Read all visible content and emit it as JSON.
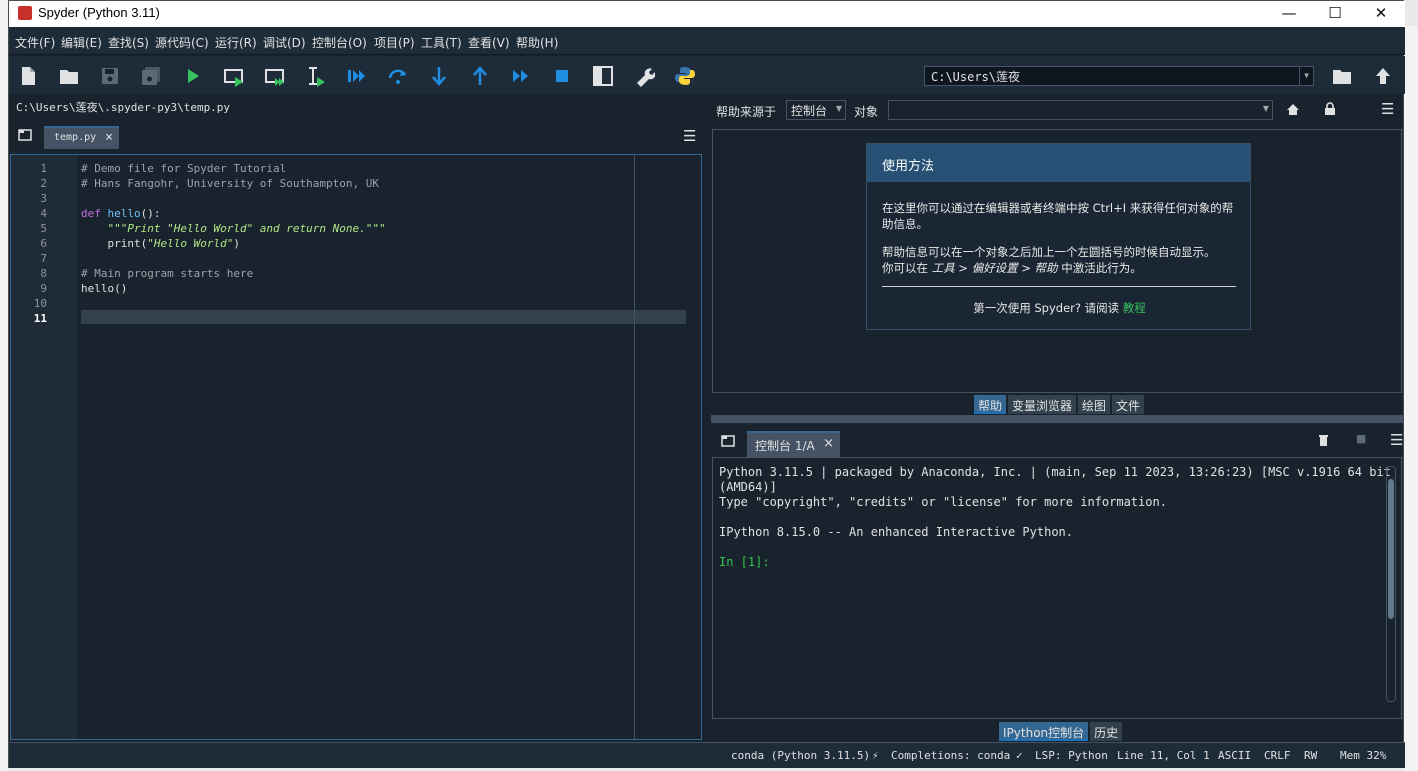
{
  "window": {
    "title": "Spyder (Python 3.11)"
  },
  "menu": [
    "文件(F)",
    "编辑(E)",
    "查找(S)",
    "源代码(C)",
    "运行(R)",
    "调试(D)",
    "控制台(O)",
    "项目(P)",
    "工具(T)",
    "查看(V)",
    "帮助(H)"
  ],
  "toolbar": {
    "working_dir": "C:\\Users\\莲夜"
  },
  "editor": {
    "path": "C:\\Users\\莲夜\\.spyder-py3\\temp.py",
    "tab_label": "temp.py",
    "current_line": 11,
    "lines": [
      "# Demo file for Spyder Tutorial",
      "# Hans Fangohr, University of Southampton, UK",
      "",
      "def hello():",
      "    \"\"\"Print \"Hello World\" and return None.\"\"\"",
      "    print(\"Hello World\")",
      "",
      "# Main program starts here",
      "hello()",
      "",
      ""
    ]
  },
  "help": {
    "source_label": "帮助来源于",
    "source_value": "控制台",
    "object_label": "对象",
    "card_title": "使用方法",
    "para1": "在这里你可以通过在编辑器或者终端中按 Ctrl+I 来获得任何对象的帮助信息。",
    "para2_line1": "帮助信息可以在一个对象之后加上一个左圆括号的时候自动显示。",
    "para2_prefix": "你可以在 ",
    "para2_path": "工具 > 偏好设置 > 帮助",
    "para2_suffix": " 中激活此行为。",
    "footer_text": "第一次使用 Spyder? 请阅读 ",
    "footer_link": "教程",
    "tabs": [
      "帮助",
      "变量浏览器",
      "绘图",
      "文件"
    ]
  },
  "console": {
    "tab_label": "控制台 1/A",
    "lines": [
      "Python 3.11.5 | packaged by Anaconda, Inc. | (main, Sep 11 2023, 13:26:23) [MSC v.1916 64 bit",
      "(AMD64)]",
      "Type \"copyright\", \"credits\" or \"license\" for more information.",
      "",
      "IPython 8.15.0 -- An enhanced Interactive Python.",
      ""
    ],
    "prompt": "In [1]:",
    "tabs": [
      "IPython控制台",
      "历史"
    ]
  },
  "status": {
    "env": "conda (Python 3.11.5)",
    "completions": "Completions: conda",
    "lsp": "LSP: Python",
    "position": "Line 11, Col 1",
    "encoding": "ASCII",
    "eol": "CRLF",
    "mode": "RW",
    "mem": "Mem 32%"
  },
  "colors": {
    "background": "#19232d",
    "accent": "#346792",
    "prompt": "#36c34a"
  }
}
